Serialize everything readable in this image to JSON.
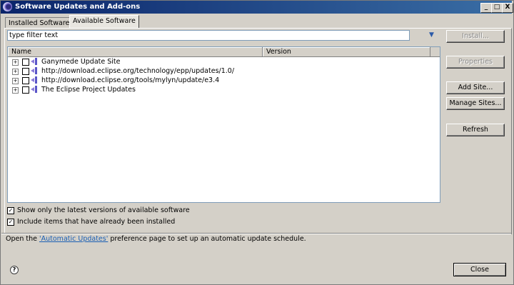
{
  "window": {
    "title": "Software Updates and Add-ons",
    "controls": [
      "_",
      "□",
      "X"
    ]
  },
  "tabs": [
    {
      "label": "Installed Software",
      "active": false
    },
    {
      "label": "Available Software",
      "active": true
    }
  ],
  "filter": {
    "value": "type filter text"
  },
  "table": {
    "columns": [
      "Name",
      "Version"
    ],
    "rows": [
      {
        "name": "Ganymede Update Site",
        "version": ""
      },
      {
        "name": "http://download.eclipse.org/technology/epp/updates/1.0/",
        "version": ""
      },
      {
        "name": "http://download.eclipse.org/tools/mylyn/update/e3.4",
        "version": ""
      },
      {
        "name": "The Eclipse Project Updates",
        "version": ""
      }
    ]
  },
  "buttons": {
    "install": "Install...",
    "properties": "Properties",
    "add_site": "Add Site...",
    "manage_sites": "Manage Sites...",
    "refresh": "Refresh",
    "close": "Close"
  },
  "options": {
    "latest_only": {
      "label": "Show only the latest versions of available software",
      "checked": true
    },
    "include_installed": {
      "label": "Include items that have already been installed",
      "checked": true
    }
  },
  "info": {
    "prefix": "Open the ",
    "link": "'Automatic Updates'",
    "suffix": " preference page to set up an automatic update schedule."
  },
  "colors": {
    "link": "#1a5fb4",
    "title_bar": "#0a246a"
  }
}
